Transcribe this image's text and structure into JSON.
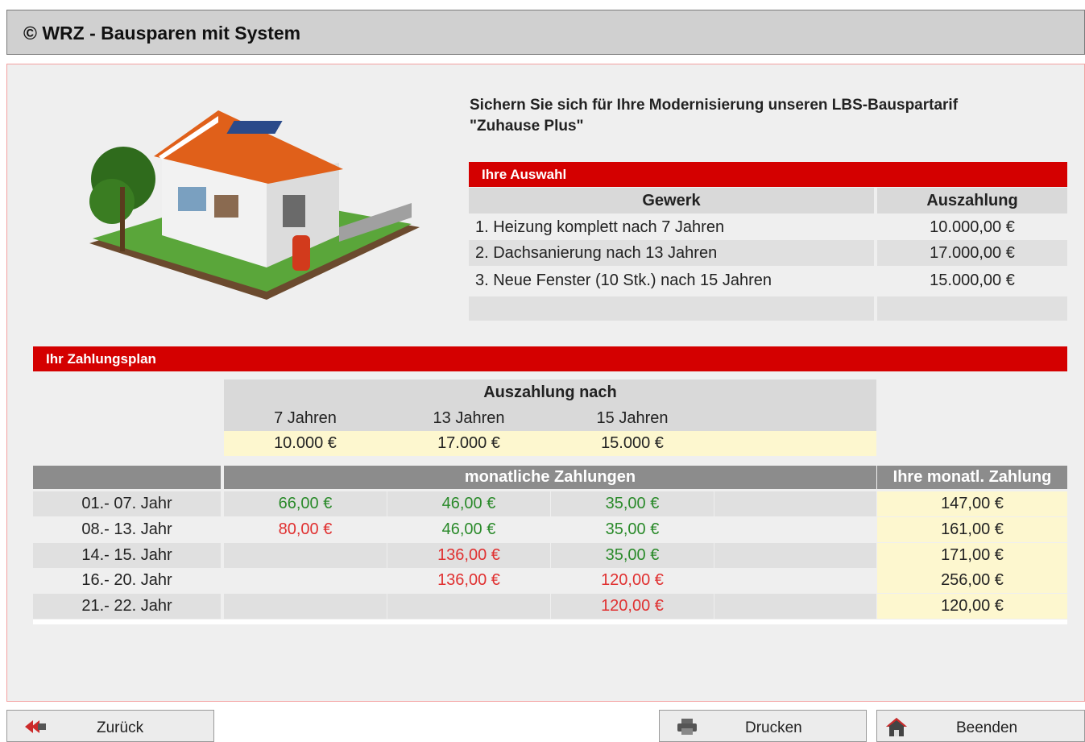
{
  "title": "© WRZ - Bausparen mit System",
  "intro": "Sichern Sie sich für Ihre Modernisierung unseren LBS-Bauspartarif \"Zuhause Plus\"",
  "auswahl": {
    "heading": "Ihre Auswahl",
    "col_gewerk": "Gewerk",
    "col_auszahlung": "Auszahlung",
    "rows": [
      {
        "gewerk": "1. Heizung komplett nach 7 Jahren",
        "auszahlung": "10.000,00 €"
      },
      {
        "gewerk": "2. Dachsanierung nach 13 Jahren",
        "auszahlung": "17.000,00 €"
      },
      {
        "gewerk": "3. Neue Fenster (10 Stk.) nach 15 Jahren",
        "auszahlung": "15.000,00 €"
      }
    ]
  },
  "plan": {
    "heading": "Ihr Zahlungsplan",
    "auszahlung_nach": "Auszahlung nach",
    "years": [
      "7 Jahren",
      "13 Jahren",
      "15 Jahren"
    ],
    "amounts": [
      "10.000 €",
      "17.000 €",
      "15.000 €"
    ],
    "monatliche": "monatliche Zahlungen",
    "ihre_monatl": "Ihre monatl. Zahlung",
    "rows": [
      {
        "period": "01.- 07. Jahr",
        "c1": "66,00 €",
        "c2": "46,00 €",
        "c3": "35,00 €",
        "total": "147,00 €"
      },
      {
        "period": "08.- 13. Jahr",
        "c1": "80,00 €",
        "c2": "46,00 €",
        "c3": "35,00 €",
        "total": "161,00 €"
      },
      {
        "period": "14.- 15. Jahr",
        "c1": "",
        "c2": "136,00 €",
        "c3": "35,00 €",
        "total": "171,00 €"
      },
      {
        "period": "16.- 20. Jahr",
        "c1": "",
        "c2": "136,00 €",
        "c3": "120,00 €",
        "total": "256,00 €"
      },
      {
        "period": "21.- 22. Jahr",
        "c1": "",
        "c2": "",
        "c3": "120,00 €",
        "total": "120,00 €"
      }
    ]
  },
  "buttons": {
    "back": "Zurück",
    "print": "Drucken",
    "quit": "Beenden"
  },
  "icons": {
    "back": "back-arrow-icon",
    "print": "printer-icon",
    "quit": "home-icon"
  },
  "colors": {
    "accent_red": "#d40000",
    "payment_green": "#2a8a2a",
    "payment_red": "#e03030",
    "highlight_yellow": "#fdf7cf"
  }
}
